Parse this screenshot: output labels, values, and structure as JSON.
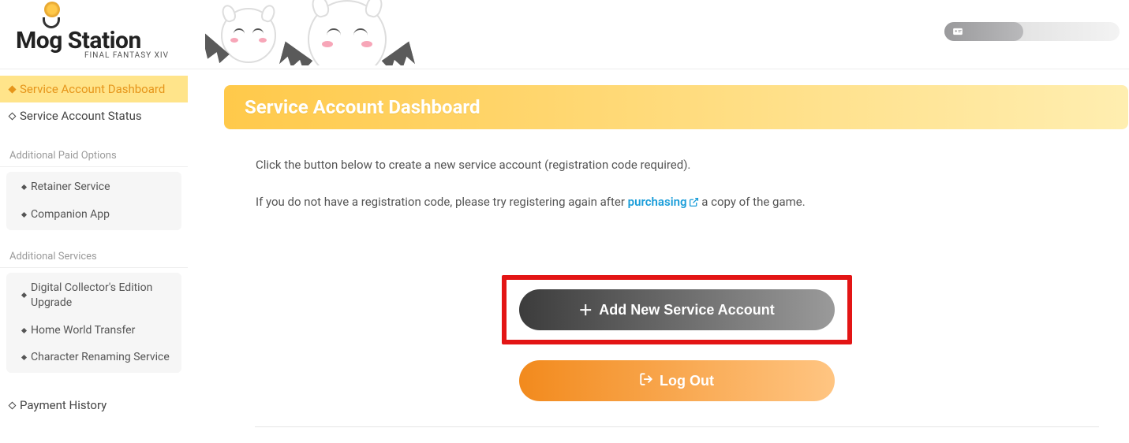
{
  "logo": {
    "main": "Mog Station",
    "sub": "FINAL FANTASY XIV"
  },
  "sidebar": {
    "main_nav": [
      {
        "label": "Service Account Dashboard",
        "active": true
      },
      {
        "label": "Service Account Status",
        "active": false
      }
    ],
    "sections": [
      {
        "title": "Additional Paid Options",
        "items": [
          {
            "label": "Retainer Service"
          },
          {
            "label": "Companion App"
          }
        ]
      },
      {
        "title": "Additional Services",
        "items": [
          {
            "label": "Digital Collector's Edition Upgrade"
          },
          {
            "label": "Home World Transfer"
          },
          {
            "label": "Character Renaming Service"
          }
        ]
      }
    ],
    "footer_item": {
      "label": "Payment History"
    }
  },
  "page": {
    "title": "Service Account Dashboard",
    "text1": "Click the button below to create a new service account (registration code required).",
    "text2a": "If you do not have a registration code, please try registering again after ",
    "purchasing": "purchasing",
    "text2b": " a copy of the game.",
    "add_button": "Add New Service Account",
    "logout_button": "Log Out"
  }
}
